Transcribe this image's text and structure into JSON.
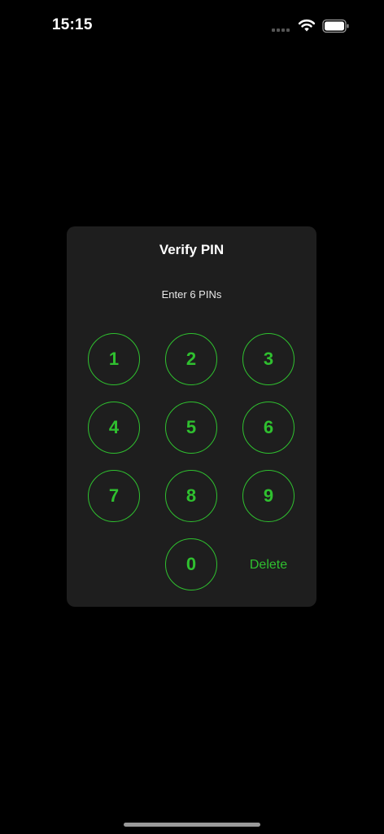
{
  "status_bar": {
    "time": "15:15",
    "icons": [
      "signal-icon",
      "wifi-icon",
      "battery-icon"
    ]
  },
  "dialog": {
    "title": "Verify PIN",
    "subtitle": "Enter 6 PINs",
    "keys": [
      "1",
      "2",
      "3",
      "4",
      "5",
      "6",
      "7",
      "8",
      "9",
      "0"
    ],
    "delete_label": "Delete"
  },
  "colors": {
    "background": "#000000",
    "dialog_background": "#1e1e1e",
    "accent": "#2fc02f"
  }
}
